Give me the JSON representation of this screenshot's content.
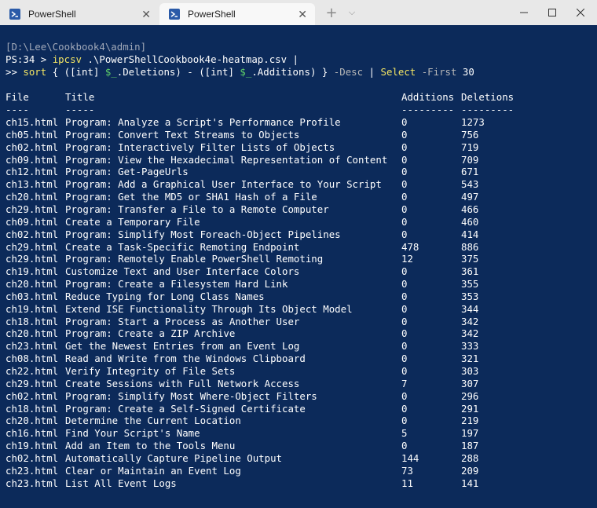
{
  "tabs": [
    {
      "label": "PowerShell",
      "active": false
    },
    {
      "label": "PowerShell",
      "active": true
    }
  ],
  "colors": {
    "terminal_bg": "#0c2a5a",
    "command_yellow": "#f5e663",
    "variable_green": "#5fd068"
  },
  "prompt": {
    "path": "[D:\\Lee\\Cookbook4\\admin]",
    "ps_prefix": "PS:34 > ",
    "cmd1": "ipcsv",
    "cmd1_arg": " .\\PowerShellCookbook4e-heatmap.csv",
    "pipe1": " |",
    "cont_prefix": ">> ",
    "cmd2": "sort",
    "cmd2_p1": " { ([int] ",
    "var1": "$_",
    "cmd2_p2": ".Deletions) - ([int] ",
    "var2": "$_",
    "cmd2_p3": ".Additions) } ",
    "desc_param": "-Desc",
    "pipe2": " | ",
    "cmd3": "Select",
    "first_param": " -First",
    "first_val": " 30"
  },
  "table": {
    "headers": {
      "file": "File",
      "title": "Title",
      "additions": "Additions",
      "deletions": "Deletions"
    },
    "underlines": {
      "file": "----",
      "title": "-----",
      "additions": "---------",
      "deletions": "---------"
    },
    "rows": [
      {
        "file": "ch15.html",
        "title": "Program: Analyze a Script's Performance Profile",
        "additions": "0",
        "deletions": "1273"
      },
      {
        "file": "ch05.html",
        "title": "Program: Convert Text Streams to Objects",
        "additions": "0",
        "deletions": "756"
      },
      {
        "file": "ch02.html",
        "title": "Program: Interactively Filter Lists of Objects",
        "additions": "0",
        "deletions": "719"
      },
      {
        "file": "ch09.html",
        "title": "Program: View the Hexadecimal Representation of Content",
        "additions": "0",
        "deletions": "709"
      },
      {
        "file": "ch12.html",
        "title": "Program: Get-PageUrls",
        "additions": "0",
        "deletions": "671"
      },
      {
        "file": "ch13.html",
        "title": "Program: Add a Graphical User Interface to Your Script",
        "additions": "0",
        "deletions": "543"
      },
      {
        "file": "ch20.html",
        "title": "Program: Get the MD5 or SHA1 Hash of a File",
        "additions": "0",
        "deletions": "497"
      },
      {
        "file": "ch29.html",
        "title": "Program: Transfer a File to a Remote Computer",
        "additions": "0",
        "deletions": "466"
      },
      {
        "file": "ch09.html",
        "title": "Create a Temporary File",
        "additions": "0",
        "deletions": "460"
      },
      {
        "file": "ch02.html",
        "title": "Program: Simplify Most Foreach-Object Pipelines",
        "additions": "0",
        "deletions": "414"
      },
      {
        "file": "ch29.html",
        "title": "Create a Task-Specific Remoting Endpoint",
        "additions": "478",
        "deletions": "886"
      },
      {
        "file": "ch29.html",
        "title": "Program: Remotely Enable PowerShell Remoting",
        "additions": "12",
        "deletions": "375"
      },
      {
        "file": "ch19.html",
        "title": "Customize Text and User Interface Colors",
        "additions": "0",
        "deletions": "361"
      },
      {
        "file": "ch20.html",
        "title": "Program: Create a Filesystem Hard Link",
        "additions": "0",
        "deletions": "355"
      },
      {
        "file": "ch03.html",
        "title": "Reduce Typing for Long Class Names",
        "additions": "0",
        "deletions": "353"
      },
      {
        "file": "ch19.html",
        "title": "Extend ISE Functionality Through Its Object Model",
        "additions": "0",
        "deletions": "344"
      },
      {
        "file": "ch18.html",
        "title": "Program: Start a Process as Another User",
        "additions": "0",
        "deletions": "342"
      },
      {
        "file": "ch20.html",
        "title": "Program: Create a ZIP Archive",
        "additions": "0",
        "deletions": "342"
      },
      {
        "file": "ch23.html",
        "title": "Get the Newest Entries from an Event Log",
        "additions": "0",
        "deletions": "333"
      },
      {
        "file": "ch08.html",
        "title": "Read and Write from the Windows Clipboard",
        "additions": "0",
        "deletions": "321"
      },
      {
        "file": "ch22.html",
        "title": "Verify Integrity of File Sets",
        "additions": "0",
        "deletions": "303"
      },
      {
        "file": "ch29.html",
        "title": "Create Sessions with Full Network Access",
        "additions": "7",
        "deletions": "307"
      },
      {
        "file": "ch02.html",
        "title": "Program: Simplify Most Where-Object Filters",
        "additions": "0",
        "deletions": "296"
      },
      {
        "file": "ch18.html",
        "title": "Program: Create a Self-Signed Certificate",
        "additions": "0",
        "deletions": "291"
      },
      {
        "file": "ch20.html",
        "title": "Determine the Current Location",
        "additions": "0",
        "deletions": "219"
      },
      {
        "file": "ch16.html",
        "title": "Find Your Script's Name",
        "additions": "5",
        "deletions": "197"
      },
      {
        "file": "ch19.html",
        "title": "Add an Item to the Tools Menu",
        "additions": "0",
        "deletions": "187"
      },
      {
        "file": "ch02.html",
        "title": "Automatically Capture Pipeline Output",
        "additions": "144",
        "deletions": "288"
      },
      {
        "file": "ch23.html",
        "title": "Clear or Maintain an Event Log",
        "additions": "73",
        "deletions": "209"
      },
      {
        "file": "ch23.html",
        "title": "List All Event Logs",
        "additions": "11",
        "deletions": "141"
      }
    ]
  }
}
